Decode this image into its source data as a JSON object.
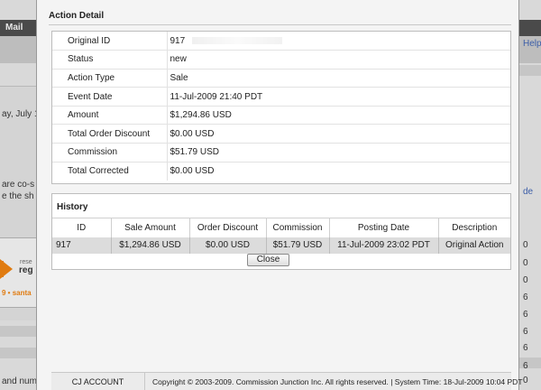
{
  "background": {
    "nav_mail": "Mail",
    "help_link": "Help",
    "date_fragment": "ay, July 1",
    "text_fragment_1": "are co-s",
    "text_fragment_2": "e the sh",
    "banner_res": "rese",
    "banner_reg": "reg",
    "banner_santa": "9 • santa",
    "footer_fragment": "and num",
    "right_values": [
      "de",
      "0",
      "0",
      "0",
      "6",
      "6",
      "6",
      "6",
      "6",
      "0",
      "0"
    ]
  },
  "modal": {
    "title": "Action Detail",
    "details": [
      {
        "label": "Original ID",
        "value": "917"
      },
      {
        "label": "Status",
        "value": "new"
      },
      {
        "label": "Action Type",
        "value": "Sale"
      },
      {
        "label": "Event Date",
        "value": "11-Jul-2009 21:40 PDT"
      },
      {
        "label": "Amount",
        "value": "$1,294.86 USD"
      },
      {
        "label": "Total Order Discount",
        "value": "$0.00 USD"
      },
      {
        "label": "Commission",
        "value": "$51.79 USD"
      },
      {
        "label": "Total Corrected",
        "value": "$0.00 USD"
      }
    ],
    "history": {
      "title": "History",
      "columns": [
        "ID",
        "Sale Amount",
        "Order Discount",
        "Commission",
        "Posting Date",
        "Description"
      ],
      "rows": [
        [
          "917",
          "$1,294.86 USD",
          "$0.00 USD",
          "$51.79 USD",
          "11-Jul-2009 23:02 PDT",
          "Original Action"
        ]
      ]
    },
    "close_label": "Close"
  },
  "footer": {
    "brand": "CJ ACCOUNT MANAGER",
    "copyright": "Copyright © 2003-2009. Commission Junction Inc. All rights reserved. | System Time: 18-Jul-2009 10:04 PDT"
  }
}
